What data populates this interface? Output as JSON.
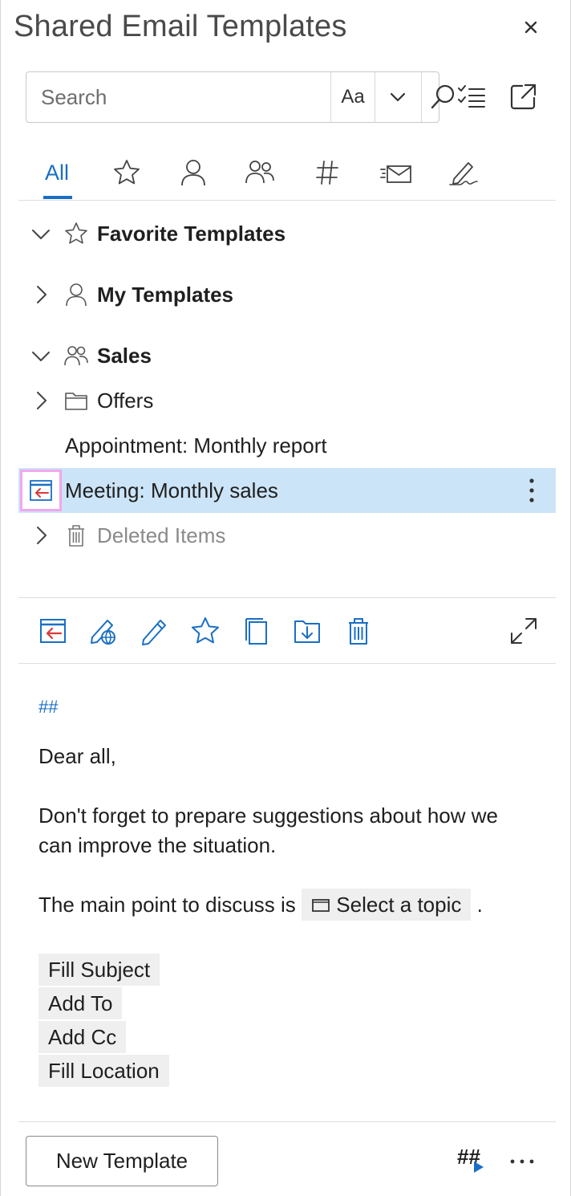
{
  "window": {
    "title": "Shared Email Templates"
  },
  "search": {
    "placeholder": "Search",
    "match_case_label": "Aa"
  },
  "tabs": [
    {
      "label": "All",
      "active": true
    },
    {
      "icon": "star-icon"
    },
    {
      "icon": "person-icon"
    },
    {
      "icon": "people-icon"
    },
    {
      "icon": "hash-icon"
    },
    {
      "icon": "mail-icon"
    },
    {
      "icon": "signature-icon"
    }
  ],
  "tree": {
    "favorites": "Favorite Templates",
    "my_templates": "My Templates",
    "sales": "Sales",
    "offers": "Offers",
    "appointment": "Appointment: Monthly report",
    "meeting": "Meeting: Monthly sales",
    "deleted": "Deleted Items"
  },
  "preview": {
    "hash": "##",
    "greeting": "Dear all,",
    "body": "Don't forget to prepare suggestions about how we can improve the situation.",
    "topic_prefix": "The main point to discuss is",
    "topic_chip": "Select a topic",
    "topic_suffix": ".",
    "fields": [
      "Fill Subject",
      "Add To",
      "Add Cc",
      "Fill Location"
    ]
  },
  "footer": {
    "new_template": "New Template",
    "macro_label": "##"
  },
  "colors": {
    "accent": "#1a6fc4",
    "selected_bg": "#cce4f7",
    "highlight_border": "#f2a6ee",
    "paste_arrow": "#d63b3b"
  }
}
